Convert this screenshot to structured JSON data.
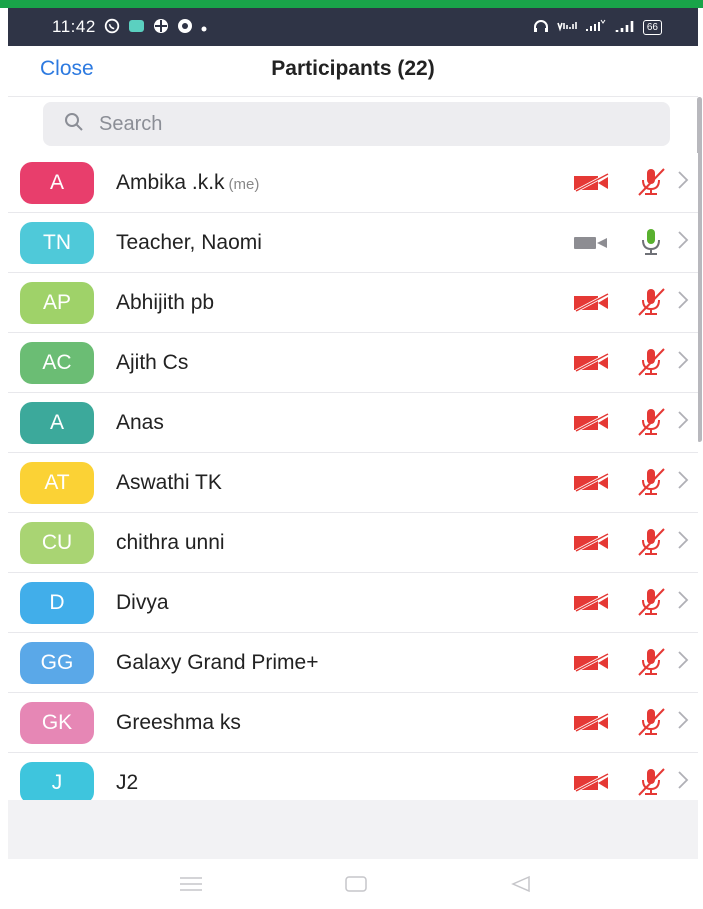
{
  "status_bar": {
    "time": "11:42",
    "left_icons": [
      "whatsapp-icon",
      "chat-icon",
      "grid-icon",
      "chrome-icon",
      "dot-icon"
    ],
    "right_icons": [
      "headphones-icon",
      "volte-icon",
      "4g-signal-icon",
      "signal-icon"
    ],
    "battery": "66"
  },
  "header": {
    "close_label": "Close",
    "title": "Participants (22)"
  },
  "search": {
    "placeholder": "Search"
  },
  "colors": {
    "accent": "#2d7ae0",
    "muted_red": "#e53935",
    "unmuted_green": "#59b12f",
    "video_on_gray": "#8d8d92"
  },
  "participants": [
    {
      "initials": "A",
      "name": "Ambika .k.k",
      "suffix": "(me)",
      "avatar_color": "#e83e6c",
      "video": "off",
      "audio": "muted"
    },
    {
      "initials": "TN",
      "name": "Teacher, Naomi",
      "suffix": "",
      "avatar_color": "#4fc9d9",
      "video": "on",
      "audio": "unmuted"
    },
    {
      "initials": "AP",
      "name": "Abhijith pb",
      "suffix": "",
      "avatar_color": "#9fd269",
      "video": "off",
      "audio": "muted"
    },
    {
      "initials": "AC",
      "name": "Ajith Cs",
      "suffix": "",
      "avatar_color": "#6bbd74",
      "video": "off",
      "audio": "muted"
    },
    {
      "initials": "A",
      "name": "Anas",
      "suffix": "",
      "avatar_color": "#3ca99b",
      "video": "off",
      "audio": "muted"
    },
    {
      "initials": "AT",
      "name": "Aswathi TK",
      "suffix": "",
      "avatar_color": "#fbd235",
      "video": "off",
      "audio": "muted"
    },
    {
      "initials": "CU",
      "name": "chithra unni",
      "suffix": "",
      "avatar_color": "#a9d473",
      "video": "off",
      "audio": "muted"
    },
    {
      "initials": "D",
      "name": "Divya",
      "suffix": "",
      "avatar_color": "#41aeea",
      "video": "off",
      "audio": "muted"
    },
    {
      "initials": "GG",
      "name": "Galaxy Grand Prime+",
      "suffix": "",
      "avatar_color": "#5aa8e8",
      "video": "off",
      "audio": "muted"
    },
    {
      "initials": "GK",
      "name": "Greeshma ks",
      "suffix": "",
      "avatar_color": "#e687b5",
      "video": "off",
      "audio": "muted"
    },
    {
      "initials": "J",
      "name": "J2",
      "suffix": "",
      "avatar_color": "#3ec5dd",
      "video": "off",
      "audio": "muted"
    }
  ],
  "nav_bar": {
    "buttons": [
      "menu-icon",
      "home-icon",
      "back-icon"
    ]
  }
}
